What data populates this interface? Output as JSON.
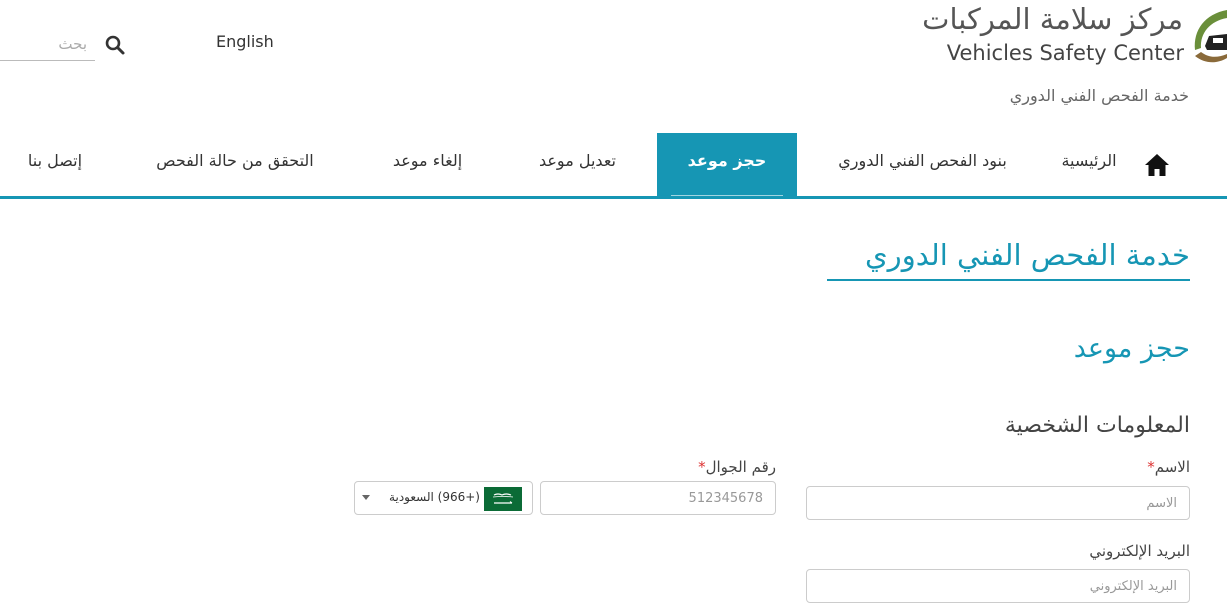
{
  "header": {
    "search_placeholder": "بحث",
    "language_link": "English",
    "logo_ar": "مركز سلامة المركبات",
    "logo_en": "Vehicles Safety Center",
    "service_name": "خدمة الفحص الفني الدوري"
  },
  "nav": {
    "items": [
      {
        "label": "الرئيسية"
      },
      {
        "label": "بنود الفحص الفني الدوري"
      },
      {
        "label": "حجز موعد",
        "active": true
      },
      {
        "label": "تعديل موعد"
      },
      {
        "label": "إلغاء موعد"
      },
      {
        "label": "التحقق من حالة الفحص"
      },
      {
        "label": "إتصل بنا"
      }
    ]
  },
  "page": {
    "title": "خدمة الفحص الفني الدوري",
    "section_title": "حجز موعد",
    "group_title": "المعلومات الشخصية"
  },
  "form": {
    "name_label": "الاسم",
    "name_placeholder": "الاسم",
    "mobile_label": "رقم الجوال",
    "mobile_placeholder": "512345678",
    "country_label": "(+966) السعودية",
    "email_label": "البريد الإلكتروني",
    "email_placeholder": "البريد الإلكتروني",
    "required_mark": "*"
  },
  "colors": {
    "accent": "#1696b4",
    "required": "#dd3333",
    "logo_green": "#6a8f3a",
    "logo_brown": "#8a6a3a",
    "flag_green": "#0b6b36"
  }
}
